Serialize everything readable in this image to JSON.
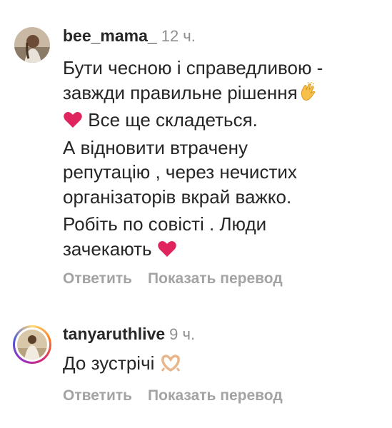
{
  "comments": [
    {
      "username": "bee_mama_",
      "time": "12 ч.",
      "paragraphs": [
        [
          "Бути чесною і справедливою -",
          "завжди правильне рішення"
        ],
        [
          "Все ще складеться."
        ],
        [
          "А відновити втрачену",
          "репутацію , через нечистих",
          "організаторів вкрай важко."
        ],
        [
          "Робіть по совісті . Люди",
          "зачекають"
        ]
      ],
      "emojis": [
        "clapping-hands-icon",
        "red-heart-icon",
        "red-heart-icon"
      ],
      "reply_label": "Ответить",
      "translate_label": "Показать перевод"
    },
    {
      "username": "tanyaruthlive",
      "time": "9 ч.",
      "paragraphs": [
        [
          "До зустрічі"
        ]
      ],
      "emojis": [
        "heart-hands-icon"
      ],
      "reply_label": "Ответить",
      "translate_label": "Показать перевод"
    }
  ],
  "colors": {
    "text": "#262626",
    "muted": "#8e8e8e",
    "action": "#a3a3a3",
    "heart": "#e0245e"
  }
}
